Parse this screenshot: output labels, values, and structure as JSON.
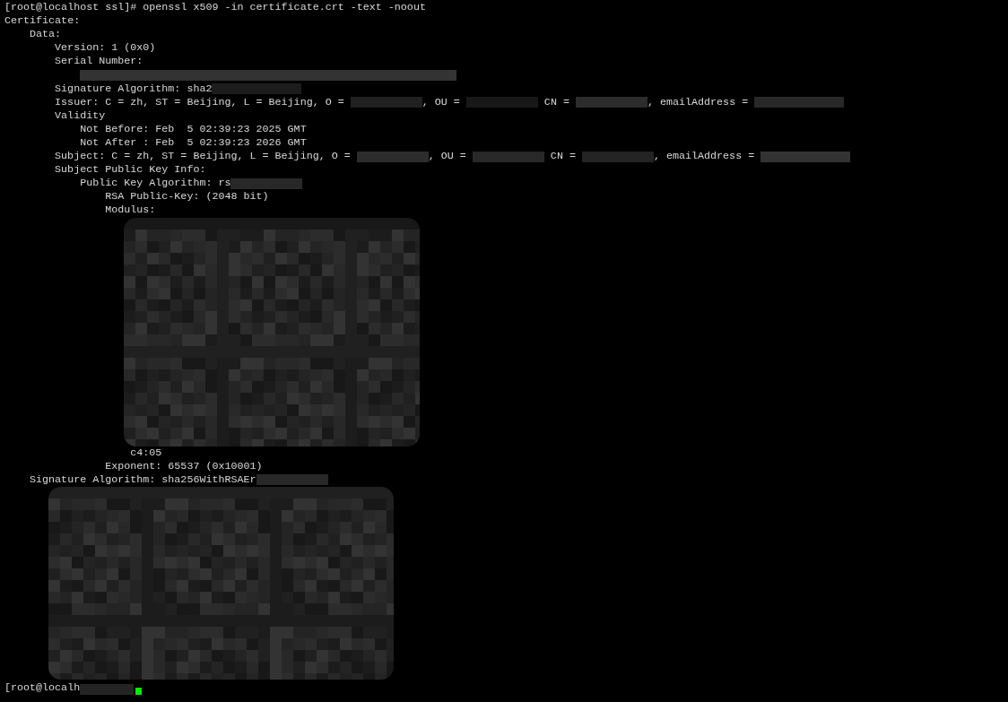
{
  "command": {
    "prompt": "[root@localhost ssl]#",
    "text": "openssl x509 -in certificate.crt -text -noout"
  },
  "output": [
    {
      "parts": [
        {
          "kind": "text",
          "text": "Certificate:"
        }
      ],
      "children": [
        {
          "parts": [
            {
              "kind": "text",
              "text": "Data:"
            }
          ],
          "children": [
            {
              "parts": [
                {
                  "kind": "text",
                  "text": "Version: 1 (0x0)"
                }
              ]
            },
            {
              "parts": [
                {
                  "kind": "text",
                  "text": "Serial Number:"
                }
              ],
              "children": [
                {
                  "parts": [
                    {
                      "kind": "redacted_wide"
                    }
                  ]
                }
              ]
            },
            {
              "parts": [
                {
                  "kind": "text",
                  "text": "Signature Algorithm: sha2"
                },
                {
                  "kind": "redacted_medium"
                }
              ]
            },
            {
              "parts": [
                {
                  "kind": "text",
                  "text": "Issuer: C = zh, ST = Beijing, L = Beijing, O = "
                },
                {
                  "kind": "redacted_small"
                },
                {
                  "kind": "text",
                  "text": ", OU = "
                },
                {
                  "kind": "redacted_small"
                },
                {
                  "kind": "text",
                  "text": " CN = "
                },
                {
                  "kind": "redacted_small"
                },
                {
                  "kind": "text",
                  "text": ", emailAddress = "
                },
                {
                  "kind": "redacted_medium"
                }
              ]
            },
            {
              "parts": [
                {
                  "kind": "text",
                  "text": "Validity"
                }
              ],
              "children": [
                {
                  "parts": [
                    {
                      "kind": "text",
                      "text": "Not Before: Feb  5 02:39:23 2025 GMT"
                    }
                  ]
                },
                {
                  "parts": [
                    {
                      "kind": "text",
                      "text": "Not After : Feb  5 02:39:23 2026 GMT"
                    }
                  ]
                }
              ]
            },
            {
              "parts": [
                {
                  "kind": "text",
                  "text": "Subject: C = zh, ST = Beijing, L = Beijing, O = "
                },
                {
                  "kind": "redacted_small"
                },
                {
                  "kind": "text",
                  "text": ", OU = "
                },
                {
                  "kind": "redacted_small"
                },
                {
                  "kind": "text",
                  "text": " CN = "
                },
                {
                  "kind": "redacted_small"
                },
                {
                  "kind": "text",
                  "text": ", emailAddress = "
                },
                {
                  "kind": "redacted_medium"
                }
              ]
            },
            {
              "parts": [
                {
                  "kind": "text",
                  "text": "Subject Public Key Info:"
                }
              ],
              "children": [
                {
                  "parts": [
                    {
                      "kind": "text",
                      "text": "Public Key Algorithm: rs"
                    },
                    {
                      "kind": "redacted_small"
                    }
                  ],
                  "children": [
                    {
                      "parts": [
                        {
                          "kind": "text",
                          "text": "RSA Public-Key: (2048 bit)"
                        }
                      ]
                    },
                    {
                      "parts": [
                        {
                          "kind": "text",
                          "text": "Modulus:"
                        }
                      ],
                      "children": [
                        {
                          "parts": [
                            {
                              "kind": "redacted_block_tall"
                            }
                          ]
                        },
                        {
                          "parts": [
                            {
                              "kind": "text",
                              "text": "c4:05"
                            }
                          ]
                        }
                      ]
                    },
                    {
                      "parts": [
                        {
                          "kind": "text",
                          "text": "Exponent: 65537 (0x10001)"
                        }
                      ]
                    }
                  ]
                }
              ]
            }
          ]
        },
        {
          "parts": [
            {
              "kind": "text",
              "text": "Signature Algorithm: sha256WithRSAEr"
            },
            {
              "kind": "redacted_small"
            }
          ],
          "children": [
            {
              "parts": [
                {
                  "kind": "redacted_block_short"
                }
              ]
            }
          ]
        }
      ]
    }
  ],
  "final_prompt": {
    "text": "[root@localh"
  }
}
